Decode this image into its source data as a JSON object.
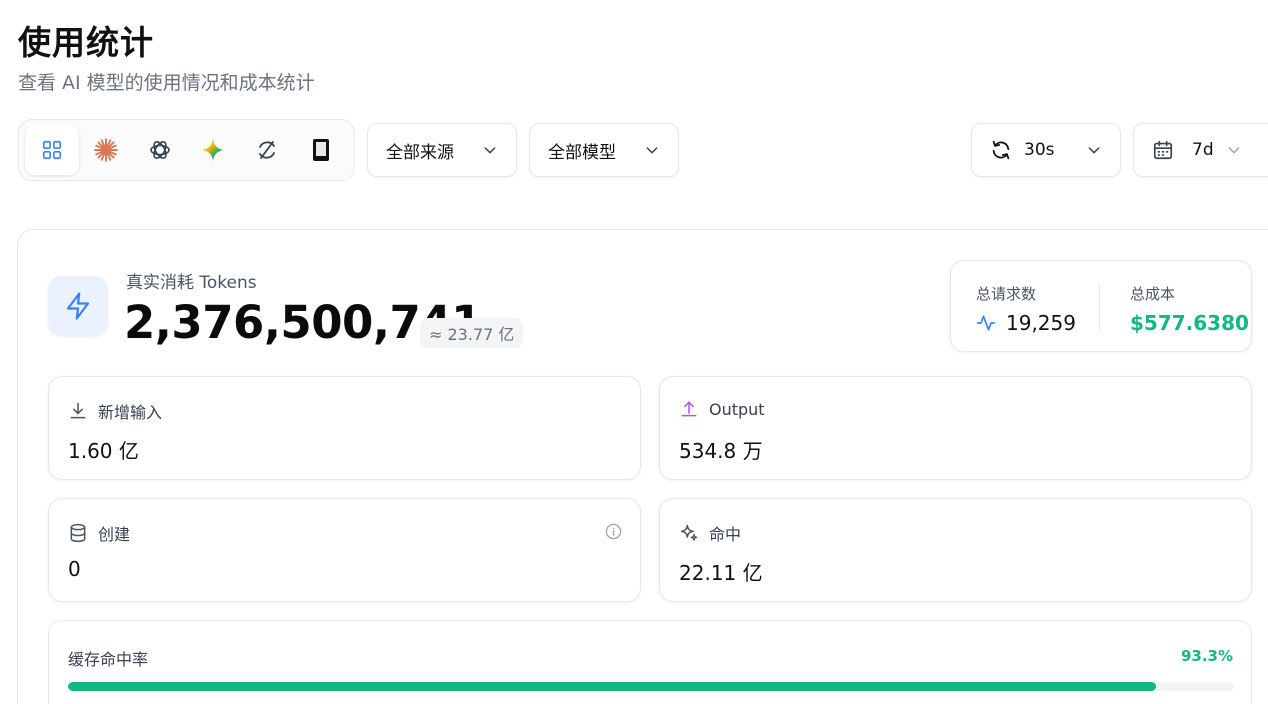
{
  "header": {
    "title": "使用统计",
    "subtitle": "查看 AI 模型的使用情况和成本统计"
  },
  "providers": [
    {
      "name": "grid-icon",
      "active": true
    },
    {
      "name": "claude-icon",
      "active": false
    },
    {
      "name": "openai-icon",
      "active": false
    },
    {
      "name": "gemini-icon",
      "active": false
    },
    {
      "name": "sync-icon",
      "active": false
    },
    {
      "name": "device-icon",
      "active": false
    }
  ],
  "filters": {
    "source_label": "全部来源",
    "model_label": "全部模型",
    "refresh_label": "30s",
    "range_label": "7d"
  },
  "tokens": {
    "label": "真实消耗 Tokens",
    "value": "2,376,500,741",
    "approx": "≈ 23.77 亿"
  },
  "summary": {
    "requests_label": "总请求数",
    "requests_value": "19,259",
    "cost_label": "总成本",
    "cost_value": "$577.6380"
  },
  "stats": {
    "input_label": "新增输入",
    "input_value": "1.60 亿",
    "output_label": "Output",
    "output_value": "534.8 万",
    "create_label": "创建",
    "create_value": "0",
    "hit_label": "命中",
    "hit_value": "22.11 亿"
  },
  "cache": {
    "label": "缓存命中率",
    "percent_text": "93.3%",
    "percent": 93.3
  },
  "colors": {
    "accent_blue": "#3b82f6",
    "success_green": "#10b981",
    "output_purple": "#a855f7",
    "claude_orange": "#d97757"
  }
}
